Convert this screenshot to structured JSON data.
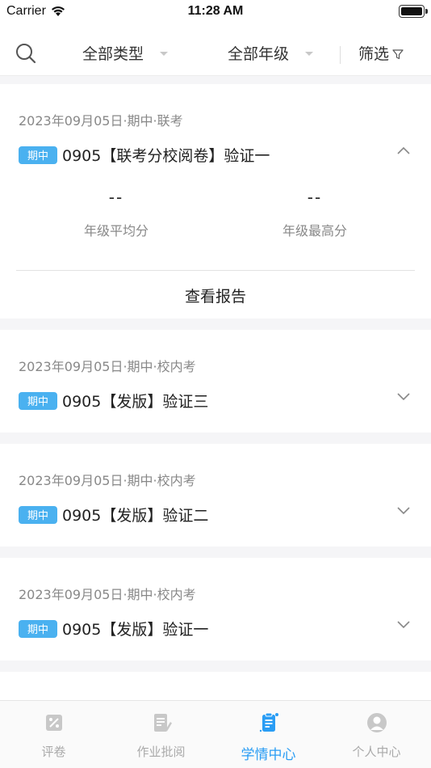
{
  "status_bar": {
    "carrier": "Carrier",
    "time": "11:28 AM"
  },
  "filters": {
    "type": "全部类型",
    "grade": "全部年级",
    "screen": "筛选"
  },
  "exams": [
    {
      "meta": "2023年09月05日·期中·联考",
      "badge": "期中",
      "title": "0905【联考分校阅卷】验证一",
      "expanded": true,
      "avg_value": "--",
      "avg_label": "年级平均分",
      "max_value": "--",
      "max_label": "年级最高分",
      "report_label": "查看报告"
    },
    {
      "meta": "2023年09月05日·期中·校内考",
      "badge": "期中",
      "title": "0905【发版】验证三",
      "expanded": false
    },
    {
      "meta": "2023年09月05日·期中·校内考",
      "badge": "期中",
      "title": "0905【发版】验证二",
      "expanded": false
    },
    {
      "meta": "2023年09月05日·期中·校内考",
      "badge": "期中",
      "title": "0905【发版】验证一",
      "expanded": false
    }
  ],
  "tabs": [
    {
      "label": "评卷",
      "icon": "grading-icon",
      "active": false
    },
    {
      "label": "作业批阅",
      "icon": "homework-icon",
      "active": false
    },
    {
      "label": "学情中心",
      "icon": "clipboard-icon",
      "active": true
    },
    {
      "label": "个人中心",
      "icon": "person-icon",
      "active": false
    }
  ],
  "colors": {
    "accent": "#2a9df4",
    "badge": "#4ab1f0",
    "inactive": "#aaaaaa"
  }
}
